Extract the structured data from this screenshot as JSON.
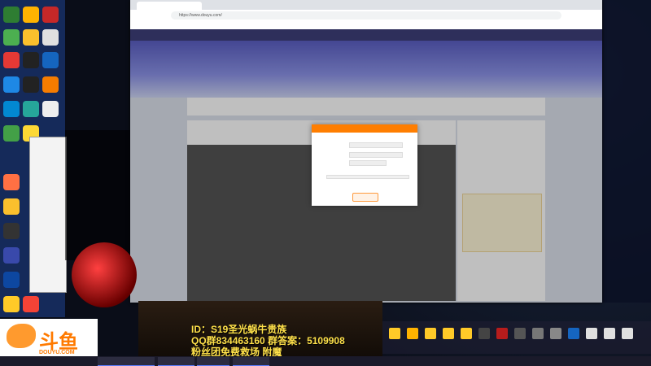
{
  "browser": {
    "tab_title": "",
    "url": "https://www.douyu.com/"
  },
  "overlay_text": {
    "line1": "ID：S19圣光蜗牛贵族",
    "line2": "QQ群834463160  群答案：5109908",
    "line3": "粉丝团免费救场 附魔"
  },
  "logo": {
    "main": "斗鱼",
    "sub": "DOUYU.COM"
  },
  "chat": {
    "lines": []
  },
  "colors": {
    "accent": "#ff7e00",
    "overlay_text": "#ffe14a",
    "site_header": "#3e3f7a"
  }
}
